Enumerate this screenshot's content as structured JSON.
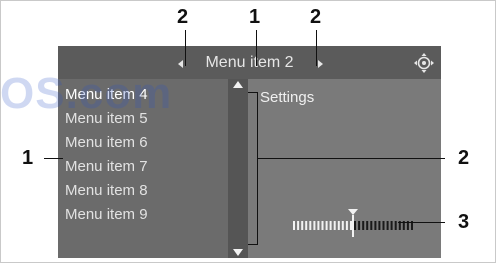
{
  "watermark": {
    "text": "OS.com"
  },
  "callouts": {
    "top_left": "2",
    "top_center": "1",
    "top_right": "2",
    "left": "1",
    "right_middle": "2",
    "right_bottom": "3"
  },
  "header": {
    "title": "Menu item 2",
    "left_arrow_icon": "triangle-left-icon",
    "right_arrow_icon": "triangle-right-icon",
    "controller_icon": "controller-knob-icon"
  },
  "menu": {
    "items": [
      {
        "label": "Menu item 4",
        "selected": true
      },
      {
        "label": "Menu item 5",
        "selected": false
      },
      {
        "label": "Menu item 6",
        "selected": false
      },
      {
        "label": "Menu item 7",
        "selected": false
      },
      {
        "label": "Menu item 8",
        "selected": false
      },
      {
        "label": "Menu item 9",
        "selected": false
      }
    ]
  },
  "scrollbar": {
    "up_icon": "triangle-up-icon",
    "down_icon": "triangle-down-icon"
  },
  "settings": {
    "label": "Settings",
    "slider_level": 0.5
  },
  "colors": {
    "screen_bg": "#6d6d6d",
    "title_bar_bg": "#5b5b5b",
    "text": "#e6e6e6",
    "watermark": "#2a52c8"
  }
}
